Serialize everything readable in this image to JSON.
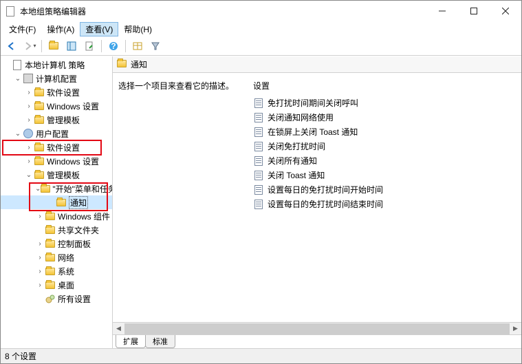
{
  "window_title": "本地组策略编辑器",
  "menu": {
    "file": "文件(F)",
    "action": "操作(A)",
    "view": "查看(V)",
    "help": "帮助(H)"
  },
  "tree": {
    "root": "本地计算机 策略",
    "computer_config": "计算机配置",
    "cc_software": "软件设置",
    "cc_windows": "Windows 设置",
    "cc_templates": "管理模板",
    "user_config": "用户配置",
    "uc_software": "软件设置",
    "uc_windows": "Windows 设置",
    "uc_templates": "管理模板",
    "start_menu": "\"开始\"菜单和任务栏",
    "notifications": "通知",
    "win_components": "Windows 组件",
    "shared_folders": "共享文件夹",
    "control_panel": "控制面板",
    "network": "网络",
    "system": "系统",
    "desktop": "桌面",
    "all_settings": "所有设置"
  },
  "content": {
    "title": "通知",
    "description_prompt": "选择一个项目来查看它的描述。",
    "settings_header": "设置",
    "settings": [
      "免打扰时间期间关闭呼叫",
      "关闭通知网络使用",
      "在锁屏上关闭 Toast 通知",
      "关闭免打扰时间",
      "关闭所有通知",
      "关闭 Toast 通知",
      "设置每日的免打扰时间开始时间",
      "设置每日的免打扰时间结束时间"
    ]
  },
  "tabs": {
    "extended": "扩展",
    "standard": "标准"
  },
  "status": "8 个设置"
}
